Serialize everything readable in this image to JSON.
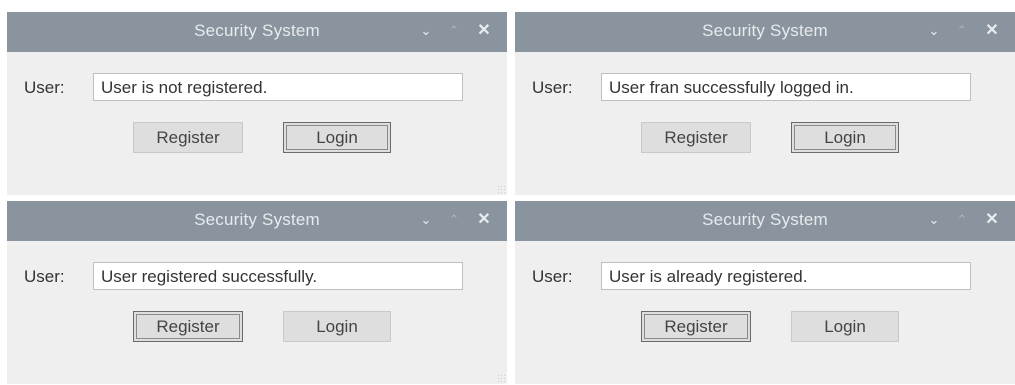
{
  "windows": [
    {
      "title": "Security System",
      "user_label": "User:",
      "status_value": "User is not registered.",
      "register_label": "Register",
      "login_label": "Login",
      "focused_button": "login"
    },
    {
      "title": "Security System",
      "user_label": "User:",
      "status_value": "User fran successfully logged in.",
      "register_label": "Register",
      "login_label": "Login",
      "focused_button": "login"
    },
    {
      "title": "Security System",
      "user_label": "User:",
      "status_value": "User registered successfully.",
      "register_label": "Register",
      "login_label": "Login",
      "focused_button": "register"
    },
    {
      "title": "Security System",
      "user_label": "User:",
      "status_value": "User is already registered.",
      "register_label": "Register",
      "login_label": "Login",
      "focused_button": "register"
    }
  ],
  "titlebar_icons": [
    "chevron-down-icon",
    "chevron-up-icon",
    "close-icon"
  ],
  "colors": {
    "titlebar": "#8a949e",
    "title_text": "#e7ebee",
    "window_bg": "#efefef",
    "button_bg": "#dedede",
    "field_bg": "#ffffff"
  }
}
